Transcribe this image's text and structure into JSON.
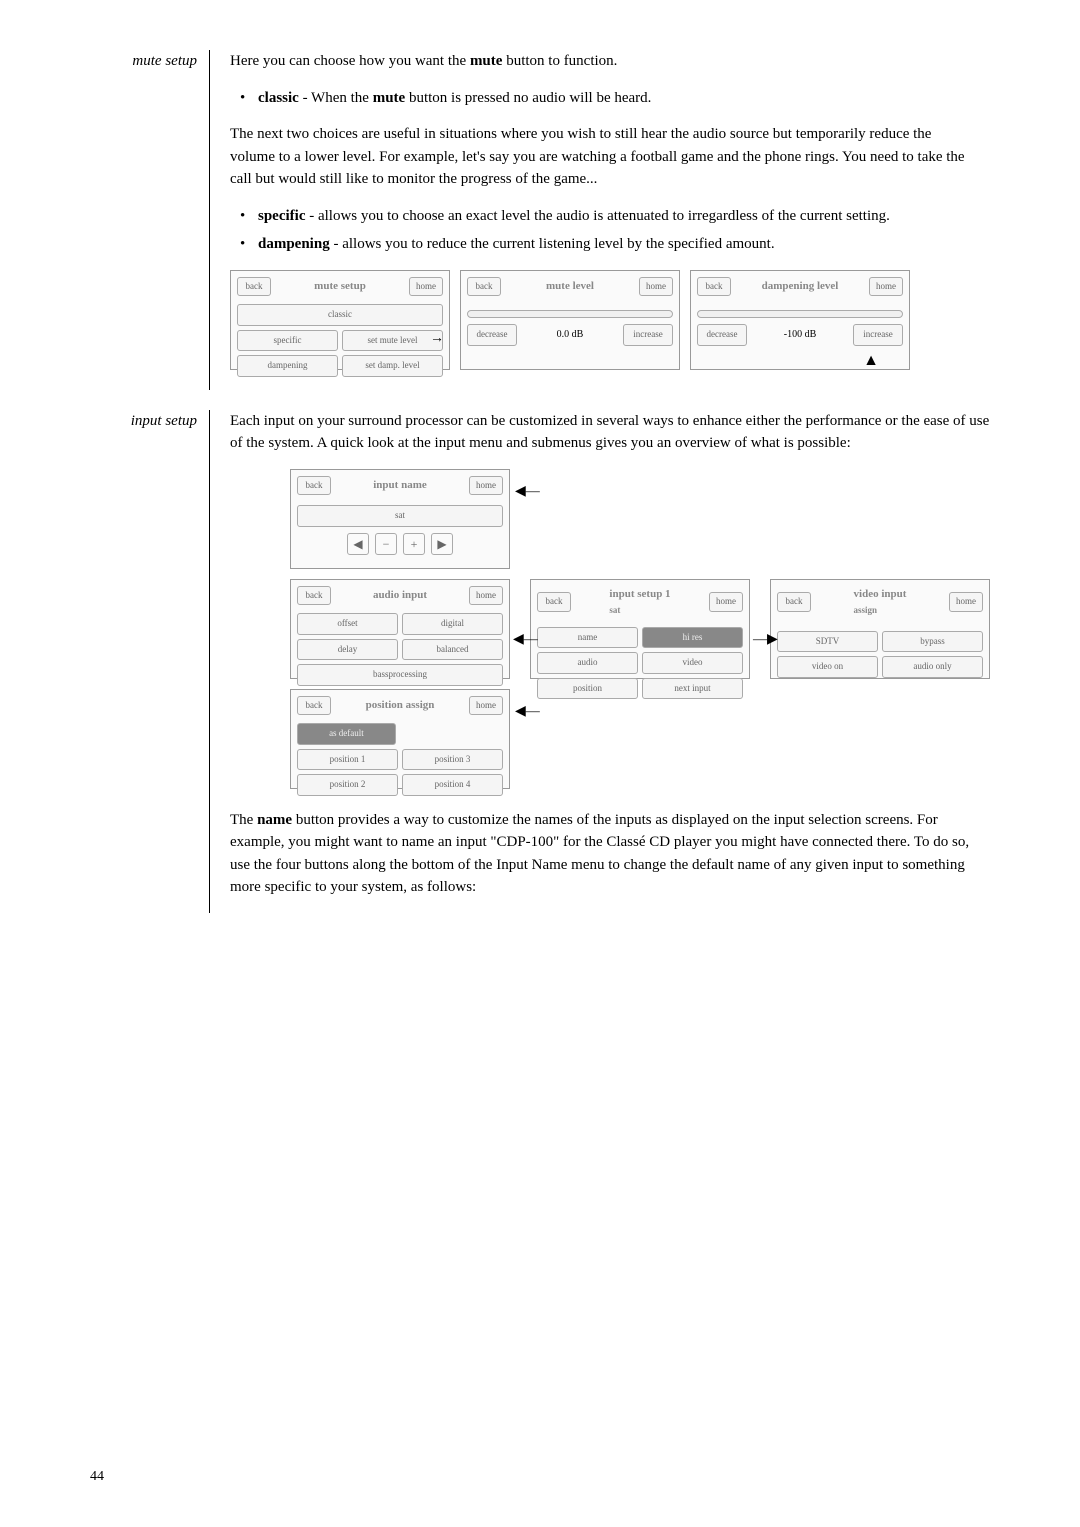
{
  "sections": {
    "mute": {
      "label": "mute setup",
      "intro": "Here you can choose how you want the ",
      "intro_bold": "mute",
      "intro_end": " button to function.",
      "classic_bold": "classic",
      "classic_text": " - When the ",
      "classic_bold2": "mute",
      "classic_end": " button is pressed no audio will be heard.",
      "para2": "The next two choices are useful in situations where you wish to still hear the audio source but temporarily reduce the volume to a lower level. For example, let's say you are watching a football game and the phone rings. You need to take the call but would still like to monitor the progress of the game...",
      "specific_bold": "specific",
      "specific_text": " - allows you to choose an exact level the audio is attenuated to irregardless of the current setting.",
      "dampening_bold": "dampening",
      "dampening_text": " - allows you to reduce the current listening level by the specified amount."
    },
    "input": {
      "label": "input setup",
      "para1": "Each input on your surround processor can be customized in several ways to enhance either the performance or the ease of use of the system. A quick look at the input menu and submenus gives you an overview of what is possible:",
      "para2a": "The ",
      "para2_bold": "name",
      "para2b": " button provides a way to customize the names of the inputs as displayed on the input selection screens. For example, you might want to name an input \"CDP-100\" for the Classé CD player you might have connected there. To do so, use the four buttons along the bottom of the Input Name menu to change the default name of any given input to something more specific to your system, as follows:"
    }
  },
  "screens": {
    "mute_setup": {
      "back": "back",
      "home": "home",
      "title": "mute setup",
      "classic": "classic",
      "specific": "specific",
      "set_mute": "set mute level",
      "dampening": "dampening",
      "set_damp": "set damp. level"
    },
    "mute_level": {
      "back": "back",
      "home": "home",
      "title": "mute level",
      "decrease": "decrease",
      "val": "0.0 dB",
      "increase": "increase"
    },
    "damp_level": {
      "back": "back",
      "home": "home",
      "title": "dampening level",
      "decrease": "decrease",
      "val": "-100 dB",
      "increase": "increase"
    },
    "input_name": {
      "back": "back",
      "home": "home",
      "title": "input name",
      "field": "sat"
    },
    "audio_input": {
      "back": "back",
      "home": "home",
      "title": "audio input",
      "offset": "offset",
      "digital": "digital",
      "delay": "delay",
      "balanced": "balanced",
      "bass": "bassprocessing"
    },
    "input_setup1": {
      "back": "back",
      "home": "home",
      "title": "input setup 1",
      "sub": "sat",
      "name": "name",
      "hires": "hi res",
      "audio": "audio",
      "video": "video",
      "position": "position",
      "next": "next input"
    },
    "video_input": {
      "back": "back",
      "home": "home",
      "title": "video input",
      "sub": "assign",
      "sdtv": "SDTV",
      "bypass": "bypass",
      "videoon": "video on",
      "audioonly": "audio only"
    },
    "position_assign": {
      "back": "back",
      "home": "home",
      "title": "position assign",
      "default": "as default",
      "pos1": "position 1",
      "pos3": "position 3",
      "pos2": "position 2",
      "pos4": "position 4"
    }
  },
  "page": "44"
}
